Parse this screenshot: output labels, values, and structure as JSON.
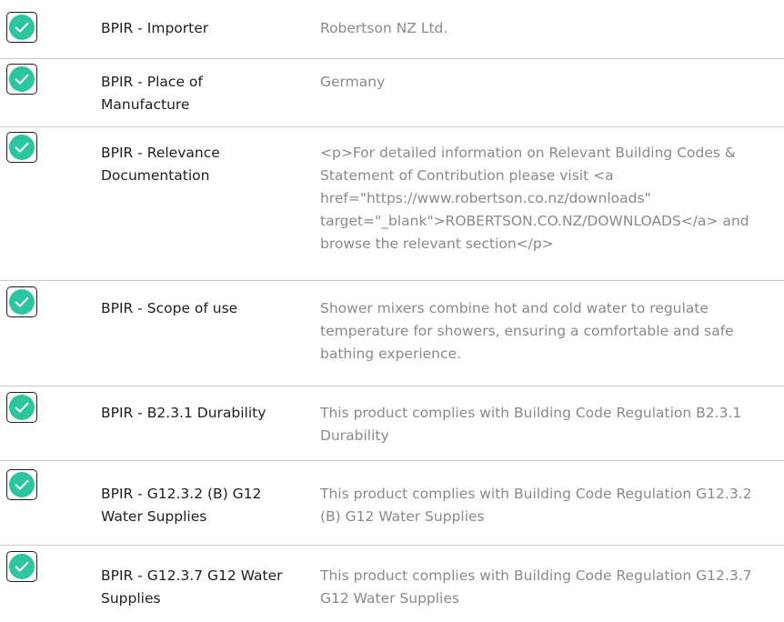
{
  "colors": {
    "check_fill": "#2bc6a0",
    "check_border": "#1e1e1e",
    "label_text": "#1f1f1f",
    "value_text": "#8a8a8a",
    "divider": "#c8c8c8"
  },
  "rows": [
    {
      "icon": "check-circle-icon",
      "label": "BPIR - Importer",
      "value": "Robertson NZ Ltd."
    },
    {
      "icon": "check-circle-icon",
      "label": "BPIR - Place of Manufacture",
      "value": "Germany"
    },
    {
      "icon": "check-circle-icon",
      "label": "BPIR - Relevance Documentation",
      "value": "<p>For detailed information on Relevant Building Codes & Statement of Contribution please visit <a href=\"https://www.robertson.co.nz/downloads\" target=\"_blank\">ROBERTSON.CO.NZ/DOWNLOADS</a> and browse the relevant section</p>"
    },
    {
      "icon": "check-circle-icon",
      "label": "BPIR - Scope of use",
      "value": "Shower mixers combine hot and cold water to regulate temperature for showers, ensuring a comfortable and safe bathing experience."
    },
    {
      "icon": "check-circle-icon",
      "label": "BPIR - B2.3.1 Durability",
      "value": "This product complies with Building Code Regulation B2.3.1 Durability"
    },
    {
      "icon": "check-circle-icon",
      "label": "BPIR - G12.3.2 (B) G12 Water Supplies",
      "value": "This product complies with Building Code Regulation G12.3.2 (B) G12 Water Supplies"
    },
    {
      "icon": "check-circle-icon",
      "label": "BPIR - G12.3.7 G12 Water Supplies",
      "value": "This product complies with Building Code Regulation G12.3.7 G12 Water Supplies"
    }
  ]
}
